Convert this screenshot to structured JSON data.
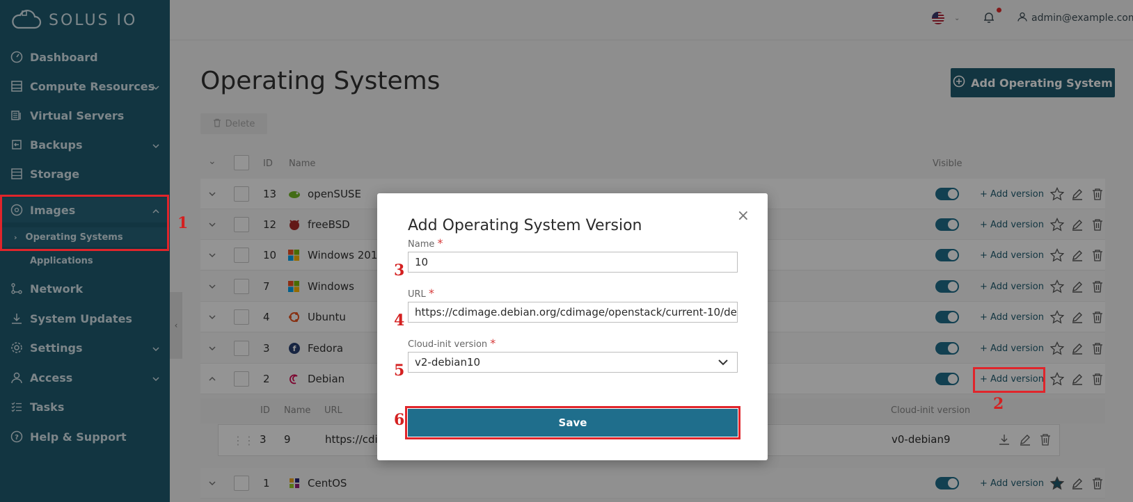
{
  "brand": {
    "name": "SOLUS IO"
  },
  "sidebar": {
    "items": [
      {
        "label": "Dashboard",
        "icon": "dashboard-icon"
      },
      {
        "label": "Compute Resources",
        "icon": "compute-icon"
      },
      {
        "label": "Virtual Servers",
        "icon": "servers-icon"
      },
      {
        "label": "Backups",
        "icon": "backup-icon"
      },
      {
        "label": "Storage",
        "icon": "storage-icon"
      },
      {
        "label": "Images",
        "icon": "images-icon"
      },
      {
        "label": "Network",
        "icon": "network-icon"
      },
      {
        "label": "System Updates",
        "icon": "download-icon"
      },
      {
        "label": "Settings",
        "icon": "gear-icon"
      },
      {
        "label": "Access",
        "icon": "user-icon"
      },
      {
        "label": "Tasks",
        "icon": "tasks-icon"
      },
      {
        "label": "Help & Support",
        "icon": "help-icon"
      }
    ],
    "sub_items": [
      "Operating Systems",
      "Applications"
    ]
  },
  "header": {
    "user": "admin@example.com"
  },
  "page": {
    "title": "Operating Systems",
    "add_button": "Add Operating System",
    "delete_button": "Delete"
  },
  "table": {
    "headers": {
      "id": "ID",
      "name": "Name",
      "visible": "Visible"
    },
    "add_version_label": "+ Add version",
    "rows": [
      {
        "id": "13",
        "name": "openSUSE"
      },
      {
        "id": "12",
        "name": "freeBSD"
      },
      {
        "id": "10",
        "name": "Windows 201"
      },
      {
        "id": "7",
        "name": "Windows"
      },
      {
        "id": "4",
        "name": "Ubuntu"
      },
      {
        "id": "3",
        "name": "Fedora"
      },
      {
        "id": "2",
        "name": "Debian"
      },
      {
        "id": "1",
        "name": "CentOS"
      }
    ],
    "sub_headers": {
      "id": "ID",
      "name": "Name",
      "url": "URL",
      "cloud_init": "Cloud-init version"
    },
    "sub_row": {
      "id": "3",
      "name": "9",
      "url": "https://cdi",
      "cloud_init": "v0-debian9"
    }
  },
  "modal": {
    "title": "Add Operating System Version",
    "name_label": "Name",
    "name_value": "10",
    "url_label": "URL",
    "url_value": "https://cdimage.debian.org/cdimage/openstack/current-10/deb",
    "cloud_label": "Cloud-init version",
    "cloud_value": "v2-debian10",
    "required_mark": "*",
    "save_label": "Save"
  },
  "steps": [
    "1",
    "2",
    "3",
    "4",
    "5",
    "6"
  ],
  "colors": {
    "sidebar": "#1f5c70",
    "accent": "#1f6e8c",
    "highlight": "#e0252b"
  }
}
